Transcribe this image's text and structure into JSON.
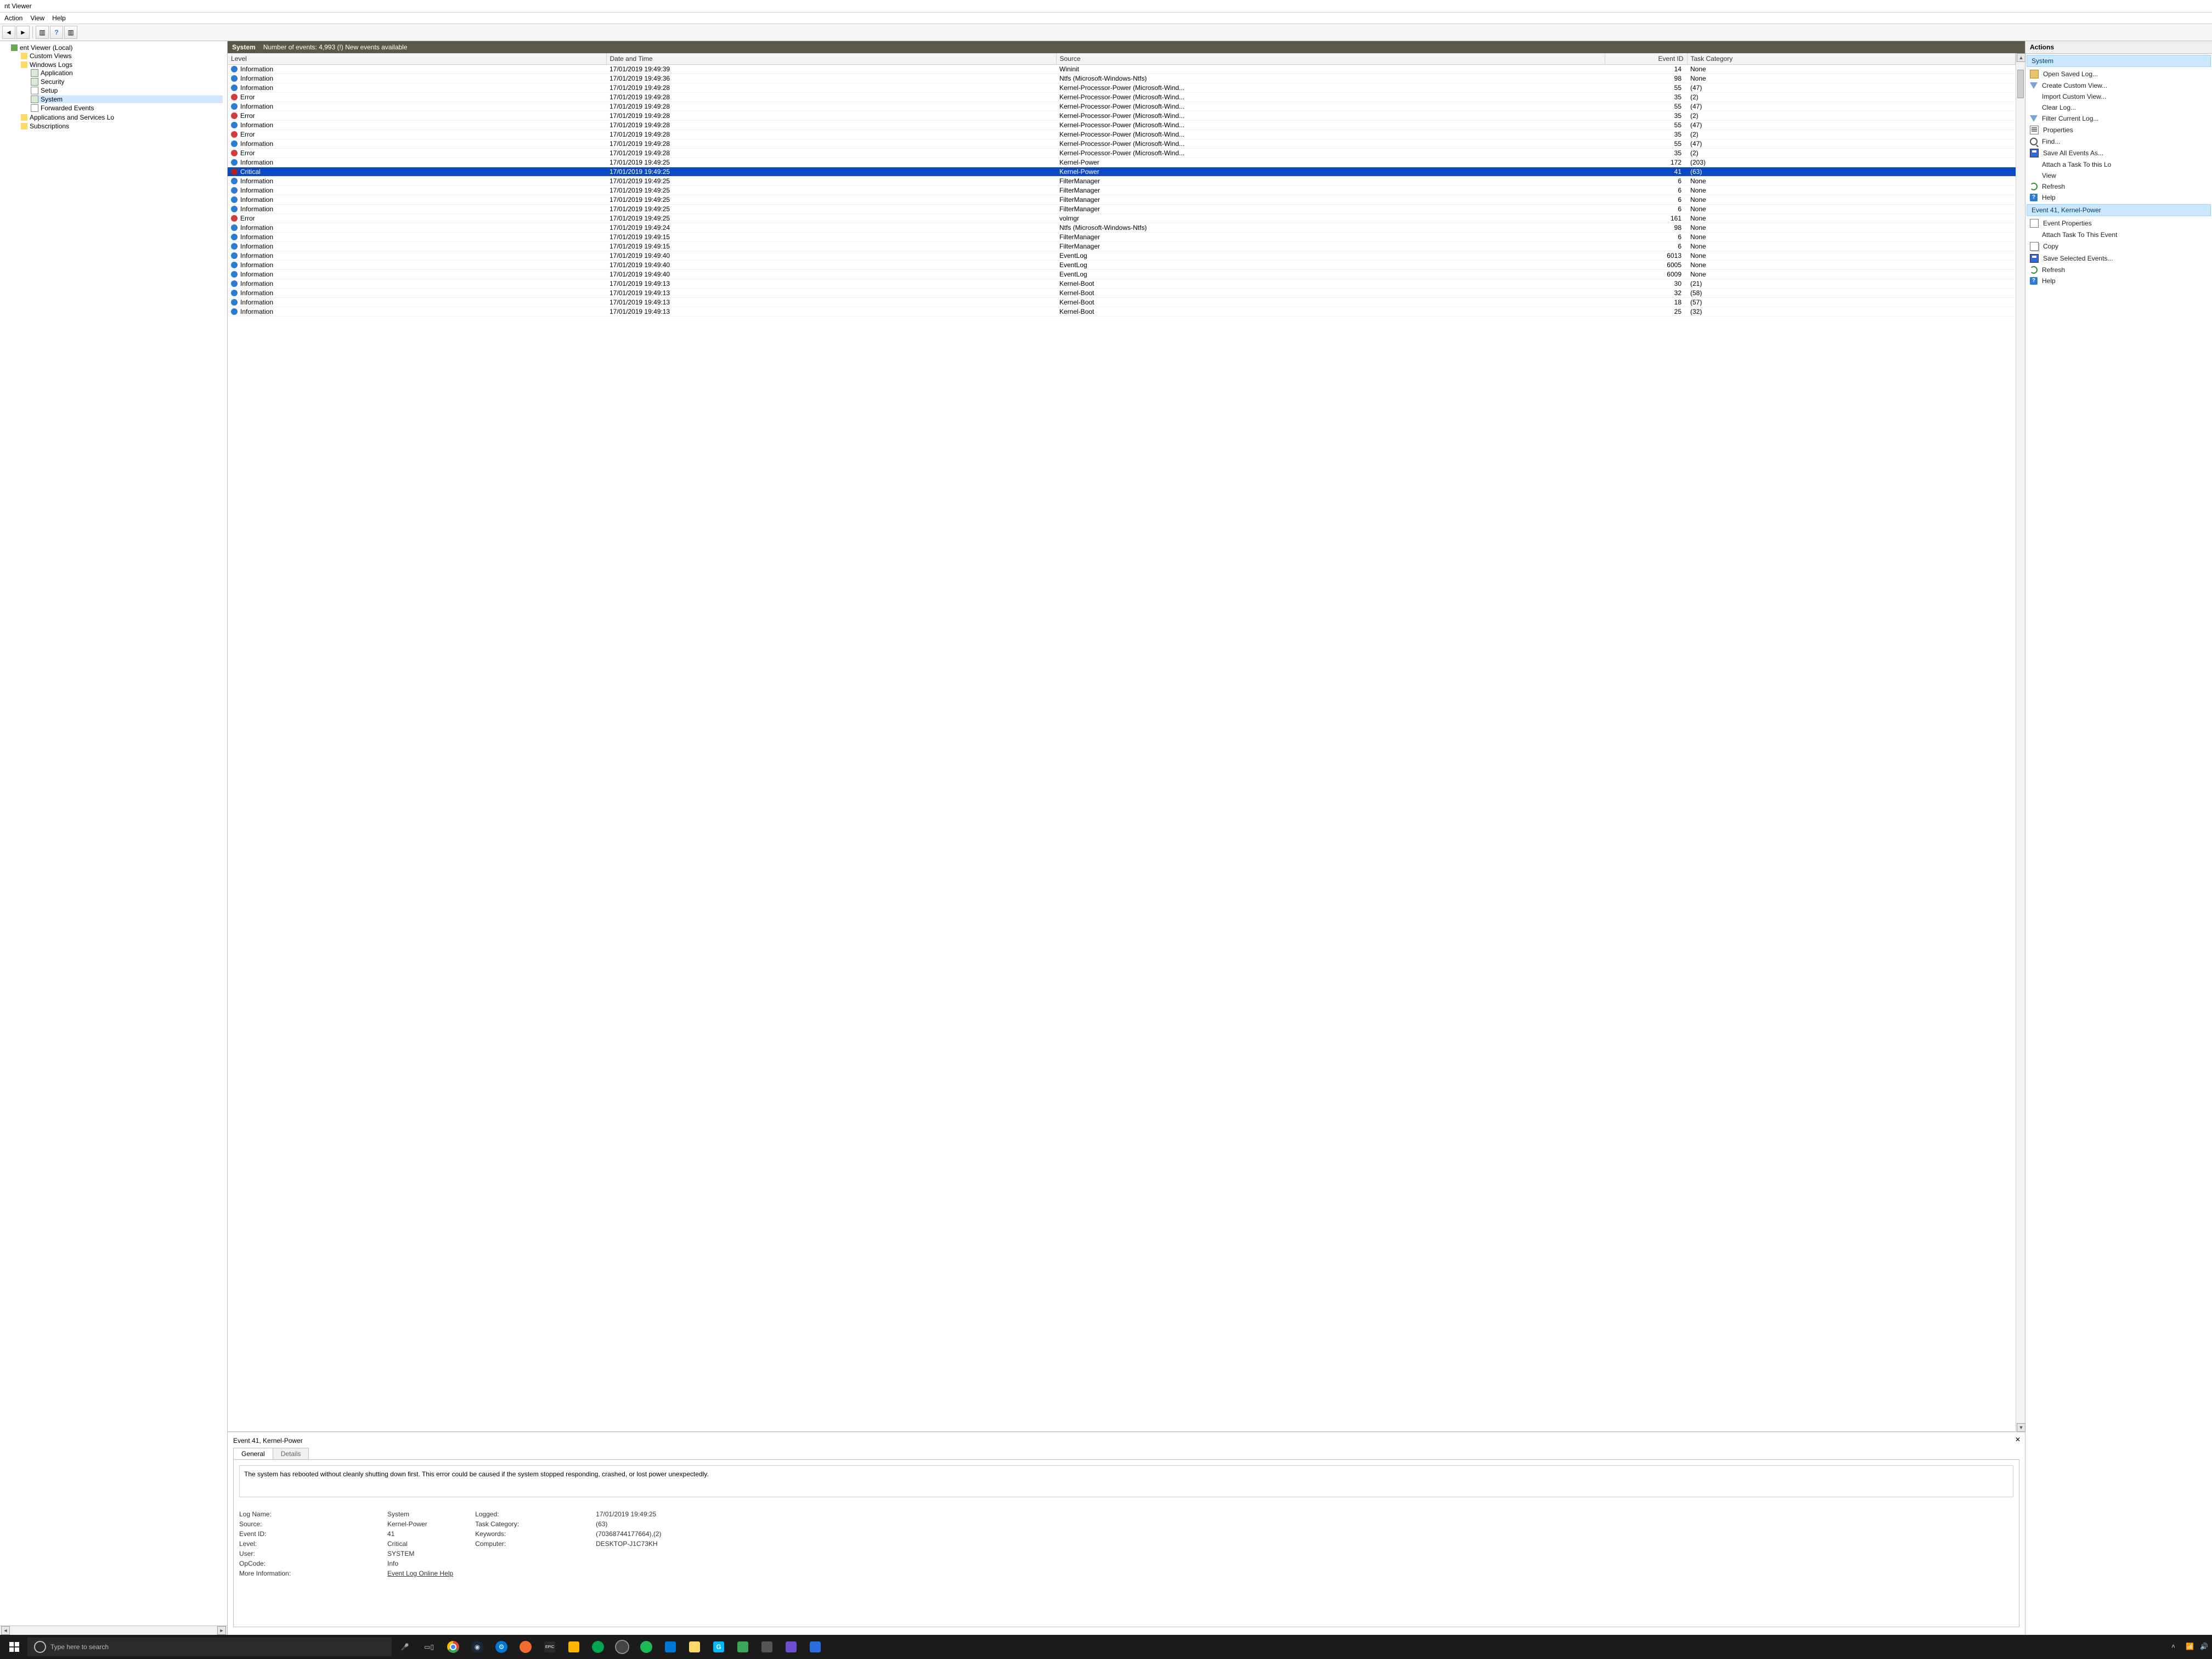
{
  "window": {
    "title": "nt Viewer"
  },
  "menu": {
    "action": "Action",
    "view": "View",
    "help": "Help"
  },
  "tree": {
    "root": "ent Viewer (Local)",
    "custom_views": "Custom Views",
    "windows_logs": "Windows Logs",
    "application": "Application",
    "security": "Security",
    "setup": "Setup",
    "system": "System",
    "forwarded": "Forwarded Events",
    "app_services": "Applications and Services Lo",
    "subscriptions": "Subscriptions"
  },
  "log_header": {
    "name": "System",
    "count": "Number of events: 4,993 (!) New events available"
  },
  "columns": {
    "level": "Level",
    "date": "Date and Time",
    "source": "Source",
    "event_id": "Event ID",
    "task": "Task Category"
  },
  "rows": [
    {
      "level": "Information",
      "dt": "17/01/2019 19:49:39",
      "src": "Wininit",
      "eid": "14",
      "task": "None",
      "sel": false,
      "icon": "info"
    },
    {
      "level": "Information",
      "dt": "17/01/2019 19:49:36",
      "src": "Ntfs (Microsoft-Windows-Ntfs)",
      "eid": "98",
      "task": "None",
      "sel": false,
      "icon": "info"
    },
    {
      "level": "Information",
      "dt": "17/01/2019 19:49:28",
      "src": "Kernel-Processor-Power (Microsoft-Wind...",
      "eid": "55",
      "task": "(47)",
      "sel": false,
      "icon": "info"
    },
    {
      "level": "Error",
      "dt": "17/01/2019 19:49:28",
      "src": "Kernel-Processor-Power (Microsoft-Wind...",
      "eid": "35",
      "task": "(2)",
      "sel": false,
      "icon": "err"
    },
    {
      "level": "Information",
      "dt": "17/01/2019 19:49:28",
      "src": "Kernel-Processor-Power (Microsoft-Wind...",
      "eid": "55",
      "task": "(47)",
      "sel": false,
      "icon": "info"
    },
    {
      "level": "Error",
      "dt": "17/01/2019 19:49:28",
      "src": "Kernel-Processor-Power (Microsoft-Wind...",
      "eid": "35",
      "task": "(2)",
      "sel": false,
      "icon": "err"
    },
    {
      "level": "Information",
      "dt": "17/01/2019 19:49:28",
      "src": "Kernel-Processor-Power (Microsoft-Wind...",
      "eid": "55",
      "task": "(47)",
      "sel": false,
      "icon": "info"
    },
    {
      "level": "Error",
      "dt": "17/01/2019 19:49:28",
      "src": "Kernel-Processor-Power (Microsoft-Wind...",
      "eid": "35",
      "task": "(2)",
      "sel": false,
      "icon": "err"
    },
    {
      "level": "Information",
      "dt": "17/01/2019 19:49:28",
      "src": "Kernel-Processor-Power (Microsoft-Wind...",
      "eid": "55",
      "task": "(47)",
      "sel": false,
      "icon": "info"
    },
    {
      "level": "Error",
      "dt": "17/01/2019 19:49:28",
      "src": "Kernel-Processor-Power (Microsoft-Wind...",
      "eid": "35",
      "task": "(2)",
      "sel": false,
      "icon": "err"
    },
    {
      "level": "Information",
      "dt": "17/01/2019 19:49:25",
      "src": "Kernel-Power",
      "eid": "172",
      "task": "(203)",
      "sel": false,
      "icon": "info"
    },
    {
      "level": "Critical",
      "dt": "17/01/2019 19:49:25",
      "src": "Kernel-Power",
      "eid": "41",
      "task": "(63)",
      "sel": true,
      "icon": "crit"
    },
    {
      "level": "Information",
      "dt": "17/01/2019 19:49:25",
      "src": "FilterManager",
      "eid": "6",
      "task": "None",
      "sel": false,
      "icon": "info"
    },
    {
      "level": "Information",
      "dt": "17/01/2019 19:49:25",
      "src": "FilterManager",
      "eid": "6",
      "task": "None",
      "sel": false,
      "icon": "info"
    },
    {
      "level": "Information",
      "dt": "17/01/2019 19:49:25",
      "src": "FilterManager",
      "eid": "6",
      "task": "None",
      "sel": false,
      "icon": "info"
    },
    {
      "level": "Information",
      "dt": "17/01/2019 19:49:25",
      "src": "FilterManager",
      "eid": "6",
      "task": "None",
      "sel": false,
      "icon": "info"
    },
    {
      "level": "Error",
      "dt": "17/01/2019 19:49:25",
      "src": "volmgr",
      "eid": "161",
      "task": "None",
      "sel": false,
      "icon": "err"
    },
    {
      "level": "Information",
      "dt": "17/01/2019 19:49:24",
      "src": "Ntfs (Microsoft-Windows-Ntfs)",
      "eid": "98",
      "task": "None",
      "sel": false,
      "icon": "info"
    },
    {
      "level": "Information",
      "dt": "17/01/2019 19:49:15",
      "src": "FilterManager",
      "eid": "6",
      "task": "None",
      "sel": false,
      "icon": "info"
    },
    {
      "level": "Information",
      "dt": "17/01/2019 19:49:15",
      "src": "FilterManager",
      "eid": "6",
      "task": "None",
      "sel": false,
      "icon": "info"
    },
    {
      "level": "Information",
      "dt": "17/01/2019 19:49:40",
      "src": "EventLog",
      "eid": "6013",
      "task": "None",
      "sel": false,
      "icon": "info"
    },
    {
      "level": "Information",
      "dt": "17/01/2019 19:49:40",
      "src": "EventLog",
      "eid": "6005",
      "task": "None",
      "sel": false,
      "icon": "info"
    },
    {
      "level": "Information",
      "dt": "17/01/2019 19:49:40",
      "src": "EventLog",
      "eid": "6009",
      "task": "None",
      "sel": false,
      "icon": "info"
    },
    {
      "level": "Information",
      "dt": "17/01/2019 19:49:13",
      "src": "Kernel-Boot",
      "eid": "30",
      "task": "(21)",
      "sel": false,
      "icon": "info"
    },
    {
      "level": "Information",
      "dt": "17/01/2019 19:49:13",
      "src": "Kernel-Boot",
      "eid": "32",
      "task": "(58)",
      "sel": false,
      "icon": "info"
    },
    {
      "level": "Information",
      "dt": "17/01/2019 19:49:13",
      "src": "Kernel-Boot",
      "eid": "18",
      "task": "(57)",
      "sel": false,
      "icon": "info"
    },
    {
      "level": "Information",
      "dt": "17/01/2019 19:49:13",
      "src": "Kernel-Boot",
      "eid": "25",
      "task": "(32)",
      "sel": false,
      "icon": "info"
    }
  ],
  "detail": {
    "title": "Event 41, Kernel-Power",
    "tab_general": "General",
    "tab_details": "Details",
    "description": "The system has rebooted without cleanly shutting down first. This error could be caused if the system stopped responding, crashed, or lost power unexpectedly.",
    "log_name_k": "Log Name:",
    "log_name_v": "System",
    "source_k": "Source:",
    "source_v": "Kernel-Power",
    "event_id_k": "Event ID:",
    "event_id_v": "41",
    "level_k": "Level:",
    "level_v": "Critical",
    "user_k": "User:",
    "user_v": "SYSTEM",
    "opcode_k": "OpCode:",
    "opcode_v": "Info",
    "more_k": "More Information:",
    "more_v": "Event Log Online Help",
    "logged_k": "Logged:",
    "logged_v": "17/01/2019 19:49:25",
    "task_k": "Task Category:",
    "task_v": "(63)",
    "keywords_k": "Keywords:",
    "keywords_v": "(70368744177664),(2)",
    "computer_k": "Computer:",
    "computer_v": "DESKTOP-J1C73KH"
  },
  "actions": {
    "pane_title": "Actions",
    "group1": "System",
    "open_saved": "Open Saved Log...",
    "create_custom": "Create Custom View...",
    "import_custom": "Import Custom View...",
    "clear_log": "Clear Log...",
    "filter_current": "Filter Current Log...",
    "properties": "Properties",
    "find": "Find...",
    "save_all": "Save All Events As...",
    "attach_task_log": "Attach a Task To this Lo",
    "view": "View",
    "refresh": "Refresh",
    "help": "Help",
    "group2": "Event 41, Kernel-Power",
    "event_props": "Event Properties",
    "attach_task_evt": "Attach Task To This Event",
    "copy": "Copy",
    "save_selected": "Save Selected Events...",
    "refresh2": "Refresh",
    "help2": "Help"
  },
  "taskbar": {
    "search_placeholder": "Type here to search"
  }
}
